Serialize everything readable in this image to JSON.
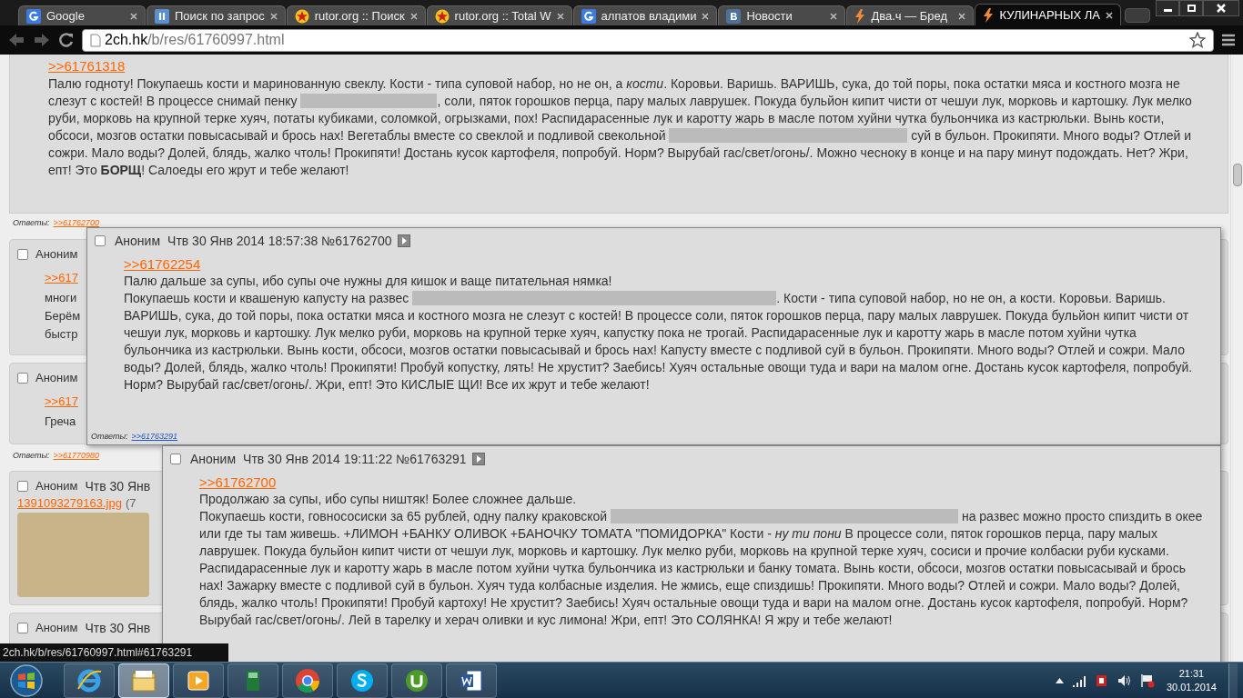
{
  "browser": {
    "tabs": [
      {
        "title": "Google",
        "selected": false
      },
      {
        "title": "Поиск по запрос",
        "selected": false
      },
      {
        "title": "rutor.org :: Поиск",
        "selected": false
      },
      {
        "title": "rutor.org :: Total W",
        "selected": false
      },
      {
        "title": "алпатов владими",
        "selected": false
      },
      {
        "title": "Новости",
        "selected": false
      },
      {
        "title": "Два.ч — Бред",
        "selected": false
      },
      {
        "title": "КУЛИНАРНЫХ ЛА",
        "selected": true
      }
    ],
    "address": {
      "host": "2ch.hk",
      "path": "/b/res/61760997.html"
    }
  },
  "thread": {
    "top_post": {
      "reply_link": ">>61761318",
      "body": [
        [
          {
            "kind": "text",
            "text": "Палю годноту! Покупаешь кости и маринованную свеклу. Кости - типа суповой набор, но не он, а *кости*. Коровьи. Варишь. ВАРИШЬ, сука, до той поры, пока остатки мяса и костного мозга не слезут с костей! В процессе снимай пенку "
          },
          {
            "kind": "spoiler"
          },
          {
            "kind": "text",
            "text": ", соли, пяток горошков перца, пару малых лаврушек. Покуда бульйон кипит чисти от чешуи лук, морковь и картошку. Лук мелко руби, морковь на крупной терке хуяч, потаты кубиками, соломкой, огрызками, пох! Распидарасенные лук и каротту жарь в масле потом хуйни чутка бульончика из кастрюльки. Вынь кости, обсоси, мозгов остатки повысасывай и брось нах! Вегетаблы вместе со свеклой и подливой свекольной "
          },
          {
            "kind": "spoiler"
          },
          {
            "kind": "text",
            "text": " суй в бульон. Прокипяти. Много воды? Отлей и сожри. Мало воды? Долей, блядь, жалко чтоль! Прокипяти! Достань кусок картофеля, попробуй. Норм? Вырубай гас/свет/огонь/. Можно чесноку в конце и на пару минут подождать. Нет? Жри, епт! Это **БОРЩ**! Салоеды его жрут и тебе желают!"
          }
        ]
      ],
      "replies_label": "Ответы:",
      "replies": [
        ">>61762700"
      ]
    },
    "side_posts": [
      {
        "checked": false,
        "name": "Аноним",
        "lines": [
          ">>617",
          "многи",
          "Берём",
          "быстр"
        ]
      },
      {
        "checked": false,
        "name": "Аноним",
        "lines": [
          ">>617",
          "Греча"
        ],
        "replies_label": "Ответы:",
        "replies": [
          ">>61770980"
        ]
      },
      {
        "checked": false,
        "name": "Аноним",
        "date": "Чтв 30 Янв",
        "file": "1391093279163.jpg",
        "file_info": "(7"
      },
      {
        "checked": false,
        "name": "Аноним",
        "date": "Чтв 30 Янв"
      }
    ],
    "popups": [
      {
        "checked": false,
        "name": "Аноним",
        "date": "Чтв 30 Янв 2014 18:57:38",
        "number": "№61762700",
        "reply_link": ">>61762254",
        "body": [
          [
            {
              "kind": "text",
              "text": "Палю дальше за супы, ибо супы оче нужны для кишок и ваще питательная нямка!"
            }
          ],
          [
            {
              "kind": "text",
              "text": "Покупаешь кости и квашеную капусту на развес "
            },
            {
              "kind": "spoiler"
            },
            {
              "kind": "text",
              "text": ". Кости - типа суповой набор, но не он, а кости. Коровьи. Варишь. ВАРИШЬ, сука, до той поры, пока остатки мяса и костного мозга не слезут с костей! В процессе соли, пяток горошков перца, пару малых лаврушек. Покуда бульйон кипит чисти от чешуи лук, морковь и картошку. Лук мелко руби, морковь на крупной терке хуяч, капустку пока не трогай. Распидарасенные лук и каротту жарь в масле потом хуйни чутка бульончика из кастрюльки. Вынь кости, обсоси, мозгов остатки повысасывай и брось нах! Капусту вместе с подливой суй в бульон. Прокипяти. Много воды? Отлей и сожри. Мало воды? Долей, блядь, жалко чтоль! Прокипяти! Пробуй копустку, лять! Не хрустит? Заебись! Хуяч остальные овощи туда и вари на малом огне. Достань кусок картофеля, попробуй. Норм? Вырубай гас/свет/огонь/. Жри, епт! Это КИСЛЫЕ ЩИ! Все их жрут и тебе желают!"
            }
          ]
        ],
        "replies_label": "Ответы:",
        "replies": [
          ">>61763291"
        ]
      },
      {
        "checked": false,
        "name": "Аноним",
        "date": "Чтв 30 Янв 2014 19:11:22",
        "number": "№61763291",
        "reply_link": ">>61762700",
        "body": [
          [
            {
              "kind": "text",
              "text": "Продолжаю за супы, ибо супы ништяк! Более сложнее дальше."
            }
          ],
          [
            {
              "kind": "text",
              "text": "Покупаешь кости, говнососиски за 65 рублей, одну палку краковской "
            },
            {
              "kind": "spoiler"
            },
            {
              "kind": "text",
              "text": " на развес можно просто спиздить в окее или где ты там живешь. +ЛИМОН +БАНКУ ОЛИВОК +БАНОЧКУ ТОМАТА \"ПОМИДОРКА\" Кости - *ну ти пони* В процессе соли, пяток горошков перца, пару малых лаврушек. Покуда бульйон кипит чисти от чешуи лук, морковь и картошку. Лук мелко руби, морковь на крупной терке хуяч, сосиси и прочие колбаски руби кусками. Распидарасенные лук и каротту жарь в масле потом хуйни чутка бульончика из кастрюльки и банку томата. Вынь кости, обсоси, мозгов остатки повысасывай и брось нах! Зажарку вместе с подливой суй в бульон. Хуяч туда колбасные изделия. Не жмись, еще спиздишь! Прокипяти. Много воды? Отлей и сожри. Мало воды? Долей, блядь, жалко чтоль! Прокипяти! Пробуй картоху! Не хрустит? Заебись! Хуяч остальные овощи туда и вари на малом огне. Достань кусок картофеля, попробуй. Норм? Вырубай гас/свет/огонь/. Лей в тарелку и херач оливки и кус лимона! Жри, епт! Это СОЛЯНКА! Я жру и тебе желают!"
            }
          ]
        ]
      }
    ]
  },
  "status_url": "2ch.hk/b/res/61760997.html#61763291",
  "taskbar": {
    "apps": [
      {
        "kind": "ie",
        "selected": false
      },
      {
        "kind": "explorer",
        "selected": true
      },
      {
        "kind": "media",
        "selected": false
      },
      {
        "kind": "book",
        "selected": false
      },
      {
        "kind": "chrome",
        "selected": false
      },
      {
        "kind": "skype",
        "selected": false
      },
      {
        "kind": "utorrent",
        "selected": false
      },
      {
        "kind": "word",
        "selected": false
      }
    ],
    "time": "21:31",
    "date": "30.01.2014"
  }
}
